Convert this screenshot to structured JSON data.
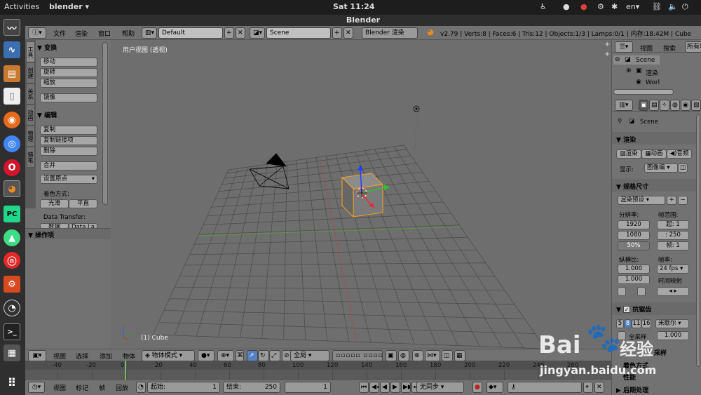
{
  "topbar": {
    "activities": "Activities",
    "app": "blender ▾",
    "clock": "Sat 11:24",
    "lang": "en▾"
  },
  "window_title": "Blender",
  "info": {
    "file": "文件",
    "render": "渲染",
    "window": "窗口",
    "help": "帮助",
    "layout": "Default",
    "scene": "Scene",
    "engine": "Blender 渲染",
    "stats": "v2.79 | Verts:8 | Faces:6 | Tris:12 | Objects:1/3 | Lamps:0/1 | 内存:18.42M | Cube"
  },
  "shelf": {
    "tabs": [
      "工具",
      "创建",
      "关系",
      "动画",
      "物理",
      "蜡笔"
    ],
    "transform": "变换",
    "move": "移动",
    "rotate": "旋转",
    "scale": "缩放",
    "mirror": "镜像",
    "edit": "编辑",
    "duplicate": "复制",
    "dup_linked": "复制链接项",
    "delete": "删除",
    "join": "合并",
    "set_origin": "设置原点",
    "shading": "着色方式:",
    "smooth": "光滑",
    "flat": "平直",
    "data_transfer": "Data Transfer:",
    "dt1": "数据",
    "dt2": "Data La",
    "operator": "操作项"
  },
  "viewport": {
    "view_label": "用户视图 (透视)",
    "object_label": "(1) Cube"
  },
  "view_header": {
    "view": "视图",
    "select": "选择",
    "add": "添加",
    "object": "物体",
    "mode": "物体模式",
    "pivot": "全局"
  },
  "timeline": {
    "ticks": [
      "-40",
      "-20",
      "0",
      "20",
      "40",
      "60",
      "80",
      "100",
      "120",
      "140",
      "160",
      "180",
      "200",
      "220",
      "240",
      "260"
    ],
    "view": "视图",
    "marker": "标记",
    "frame": "帧",
    "playback": "回放",
    "start_label": "起始:",
    "start": "1",
    "end_label": "结束:",
    "end": "250",
    "current": "1",
    "sync": "无同步"
  },
  "outliner": {
    "view": "视图",
    "search": "搜索",
    "all": "所有场",
    "scene": "Scene",
    "render_layers": "渲染",
    "world": "Worl"
  },
  "props": {
    "scene": "Scene",
    "render": "渲染",
    "btn_render": "渲染",
    "btn_anim": "动画",
    "btn_audio": "音频",
    "display_label": "显示:",
    "display": "图像编",
    "dimensions": "规格尺寸",
    "preset": "渲染预设",
    "resolution": "分辨率:",
    "res_x": "1920",
    "res_y": "1080",
    "res_pct": "50%",
    "frame_range": "帧范围:",
    "f_start": "起: 1",
    "f_end": ": 250",
    "f_step": "帧: 1",
    "aspect": "纵横比:",
    "asp_x": "1.000",
    "asp_y": "1.000",
    "fps_label": "帧率:",
    "fps": "24 fps",
    "time_remap": "时间映射",
    "aa": "抗锯齿",
    "aa5": "5",
    "aa8": "8",
    "aa11": "11",
    "aa16": "16",
    "filter": "米歇尔",
    "full_sample": "全采样",
    "fs_val": "1.000",
    "sampled_motion": "采样",
    "shading": "着色方式",
    "performance": "性能",
    "post": "后期处理"
  },
  "watermark": {
    "brand": "Bai",
    "brand2": "经验",
    "url": "jingyan.baidu.com"
  },
  "colors": {
    "grid": "#4a4a4a",
    "x_axis": "#a05050",
    "y_axis": "#5c9a3a",
    "select": "#ff9e1a"
  }
}
